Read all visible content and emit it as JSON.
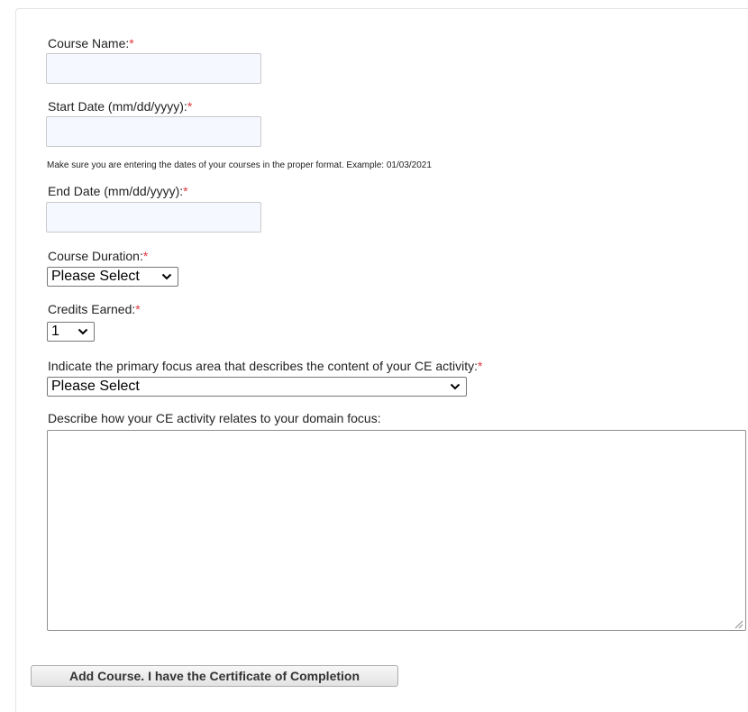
{
  "form": {
    "required_marker": "*",
    "course_name": {
      "label": "Course Name:",
      "value": ""
    },
    "start_date": {
      "label": "Start Date (mm/dd/yyyy):",
      "value": ""
    },
    "date_hint": "Make sure you are entering the dates of your courses in the proper format. Example: 01/03/2021",
    "end_date": {
      "label": "End Date (mm/dd/yyyy):",
      "value": ""
    },
    "course_duration": {
      "label": "Course Duration:",
      "selected": "Please Select"
    },
    "credits_earned": {
      "label": "Credits Earned:",
      "selected": "1"
    },
    "focus_area": {
      "label": "Indicate the primary focus area that describes the content of your CE activity:",
      "selected": "Please Select"
    },
    "domain_focus": {
      "label": "Describe how your CE activity relates to your domain focus:",
      "value": ""
    },
    "submit_label": "Add Course. I have the Certificate of Completion"
  },
  "icons": {
    "dropdown": "chevron-down-icon",
    "resize": "resize-grip-icon"
  },
  "colors": {
    "required": "#e0383e",
    "input_background": "#f6f8ff"
  }
}
